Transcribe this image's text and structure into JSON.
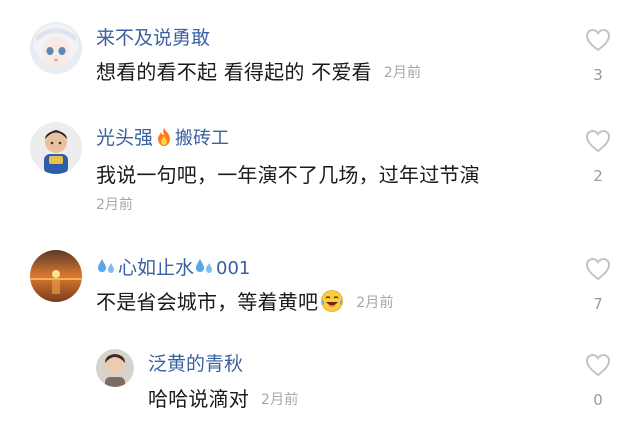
{
  "comments": [
    {
      "username": "来不及说勇敢",
      "text": "想看的看不起 看得起的 不爱看",
      "time": "2月前",
      "likes": "3",
      "avatar_icon": "doll-avatar"
    },
    {
      "username": "光头强",
      "username_suffix": "搬砖工",
      "badge_icon": "fire-icon",
      "text": "我说一句吧，一年演不了几场，过年过节演",
      "time": "2月前",
      "likes": "2",
      "avatar_icon": "child-avatar"
    },
    {
      "username_prefix_icon": "droplets-icon",
      "username": "心如止水",
      "username_suffix": "001",
      "text": "不是省会城市，等着黄吧",
      "text_emoji": "laughing-tears-emoji",
      "time": "2月前",
      "likes": "7",
      "avatar_icon": "sunset-avatar"
    },
    {
      "username": "泛黄的青秋",
      "text": "哈哈说滴对",
      "time": "2月前",
      "likes": "0",
      "avatar_icon": "person-avatar",
      "is_reply": true
    }
  ],
  "colors": {
    "username": "#3b5fa0",
    "text": "#1a1a1a",
    "meta": "#a7a7a7",
    "heart_outline": "#c4c4c4"
  }
}
